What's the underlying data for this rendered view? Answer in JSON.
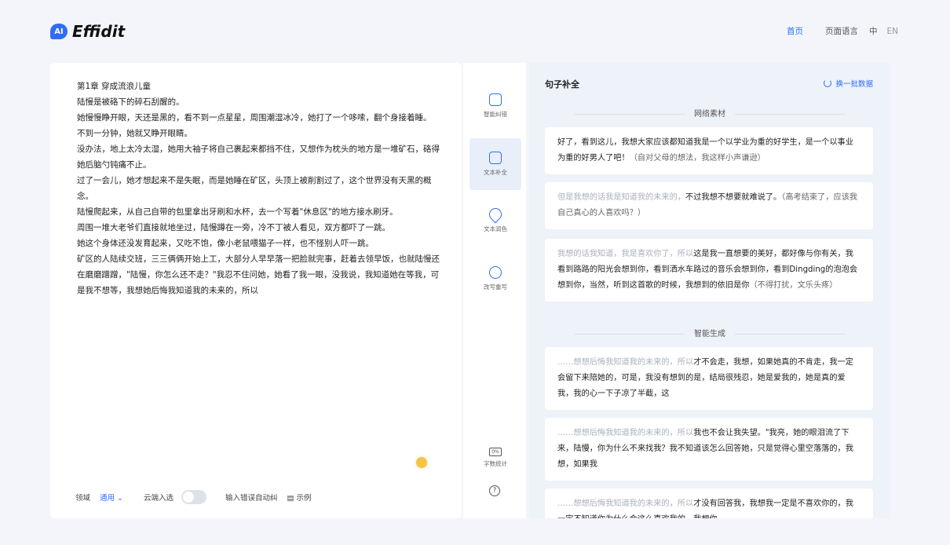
{
  "header": {
    "logo_mark": "AI",
    "logo_text_a": "Eff",
    "logo_text_i": "i",
    "logo_text_b": "dit",
    "nav_home": "首页",
    "nav_lang_label": "页面语言",
    "nav_lang_zh": "中",
    "nav_lang_en": "EN"
  },
  "editor": {
    "lines": [
      "第1章 穿成流浪儿童",
      "陆慢是被硌下的碎石刮醒的。",
      "她慢慢睁开眼，天还是黑的，看不到一点星星，周围潮湿冰冷，她打了一个哆嗦，翻个身接着睡。",
      "不到一分钟，她就又睁开眼睛。",
      "没办法，地上太冷太湿，她用大袖子将自己裹起来都挡不住，又想作为枕头的地方是一堆矿石，硌得她后脑勺钝痛不止。",
      "过了一会儿，她才想起来不是失眠，而是她睡在矿区，头顶上被削割过了，这个世界没有天黑的概念。",
      "陆慢爬起来，从自己自带的包里拿出牙刷和水杯，去一个写着\"休息区\"的地方接水刷牙。",
      "周围一堆大老爷们直接就地坐过，陆慢蹲在一旁，冷不丁被人看见，双方都吓了一跳。",
      "她这个身体还没发育起来，又吃不饱，像小老鼠喂猫子一样，也不怪别人吓一跳。",
      "矿区的人陆续交班，三三俩俩开始上工，大部分人早早落一把脸就完事，赶着去领早饭，也就陆慢还在磨磨蹭蹭，\"陆慢，你怎么还不走？\"我忍不住问她，她看了我一眼，没我说，我知道她在等我，可是我不想等，我想她后悔我知道我的未来的，所以"
    ],
    "footer_label_mode": "领域",
    "footer_mode_value": "通用 ⌄",
    "footer_label_cloud": "云端入选",
    "footer_label_input": "输入错误自动纠",
    "footer_example": "▤ 示例"
  },
  "tools": {
    "t1": "智能纠错",
    "t2": "文本补全",
    "t3": "文本润色",
    "t4": "改写重写",
    "bottom1_box": "0%",
    "bottom1": "字数统计",
    "help": "?"
  },
  "panel": {
    "title": "句子补全",
    "batch": "换一批数据",
    "section1": "网络素材",
    "section2": "智能生成",
    "cards": [
      {
        "faint": "",
        "text": "好了，看到这儿，我想大家应该都知道我是一个以学业为重的好学生，是一个以事业为重的好男人了吧！",
        "muted": "（自对父母的想法，我这样小声谦逊）"
      },
      {
        "faint": "但是我想的话我是知道我的未来的，",
        "text": "不过我想不想要就难说了。",
        "muted": "（高考结束了，应该我自己真心的人喜欢吗？）"
      },
      {
        "faint": "我想的话我知道，我是喜欢你了，所以",
        "text": "这是我一直想要的美好，都好像与你有关，我看到路路的阳光会想到你，看到洒水车路过的音乐会想到你，看到Dingding的泡泡会想到你，当然，听到这首歌的时候，我想到的依旧是你",
        "muted": "（不得打扰，文乐头疼）"
      },
      {
        "faint": "……想想后悔我知道我的未来的，所以",
        "text": "才不会走，我想，如果她真的不肯走，我一定会留下来陪她的，可是，我没有想到的是，结局很残忍，她是爱我的，她是真的爱我，我的心一下子凉了半截，这",
        "muted": ""
      },
      {
        "faint": "……想想后悔我知道我的未来的，所以",
        "text": "我也不会让我失望。\"我亮，她的眼泪流了下来，陆慢，你为什么不来找我？我不知道该怎么回答她，只是觉得心里空落落的，我想，如果我",
        "muted": ""
      },
      {
        "faint": "……想想后悔我知道我的未来的，所以",
        "text": "才没有回答我，我想我一定是不喜欢你的，我一定不知道你为什么会这么喜欢我的，我想你",
        "muted": ""
      }
    ]
  }
}
